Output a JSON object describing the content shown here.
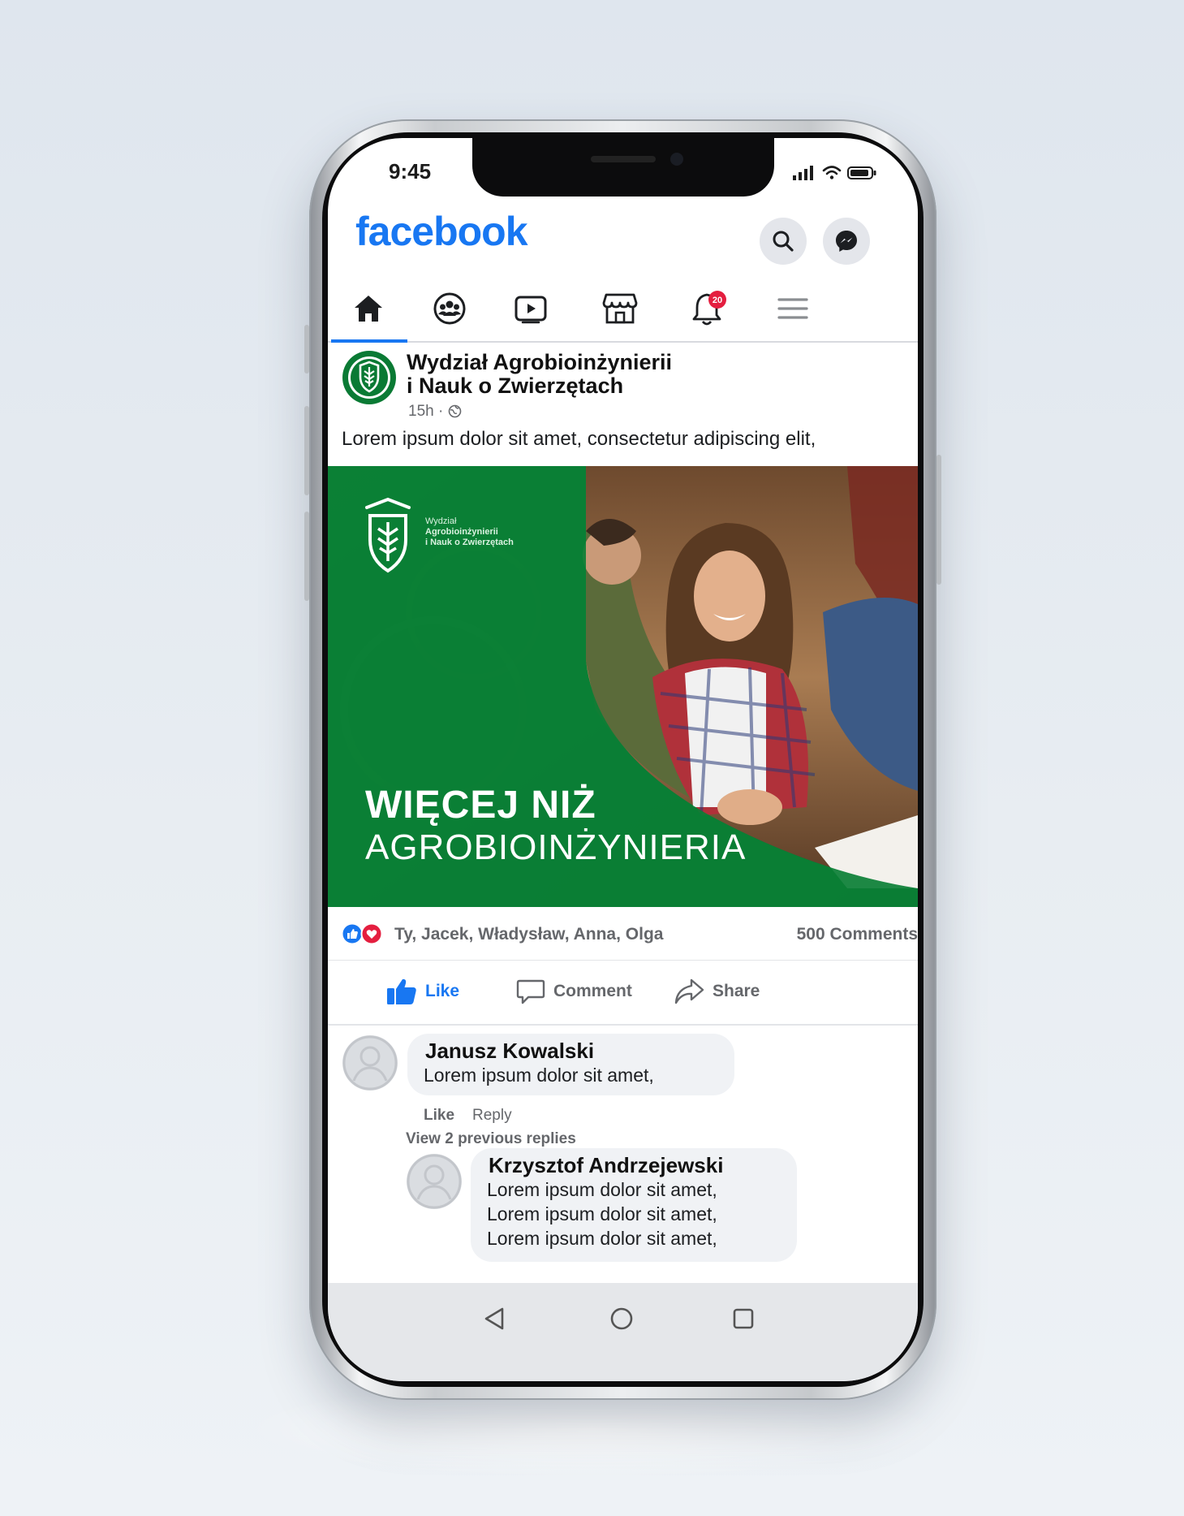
{
  "status_bar": {
    "time": "9:45"
  },
  "app": {
    "logo": "facebook"
  },
  "header_icons": [
    "search-icon",
    "messenger-icon"
  ],
  "nav": {
    "items": [
      "home-icon",
      "groups-icon",
      "watch-icon",
      "marketplace-icon",
      "notifications-icon",
      "menu-icon"
    ],
    "active": "home-icon",
    "notification_badge": "20"
  },
  "post": {
    "author_line1": "Wydział Agrobioinżynierii",
    "author_line2": "i Nauk o Zwierzętach",
    "meta": "15h · ",
    "text": "Lorem ipsum dolor sit amet, consectetur adipiscing elit,",
    "banner": {
      "logo_text_1": "Wydział",
      "logo_text_2": "Agrobioinżynierii",
      "logo_text_3": "i Nauk o Zwierzętach",
      "title_line1": "WIĘCEJ NIŻ",
      "title_line2": "AGROBIOINŻYNIERIA"
    },
    "reactions_names": "Ty, Jacek, Władysław, Anna, Olga",
    "comments_count": "500 Comments",
    "actions": {
      "like": "Like",
      "comment": "Comment",
      "share": "Share"
    }
  },
  "comments": [
    {
      "name": "Janusz Kowalski",
      "lines": [
        "Lorem ipsum dolor sit amet,"
      ],
      "like": "Like",
      "reply": "Reply",
      "view_replies": "View 2 previous replies"
    },
    {
      "name": "Krzysztof Andrzejewski",
      "lines": [
        "Lorem ipsum dolor sit amet,",
        "Lorem ipsum dolor sit amet,",
        "Lorem ipsum dolor sit amet,"
      ]
    }
  ],
  "colors": {
    "facebook_blue": "#1877f2",
    "brand_green": "#0b7f35",
    "muted_text": "#65676b"
  }
}
